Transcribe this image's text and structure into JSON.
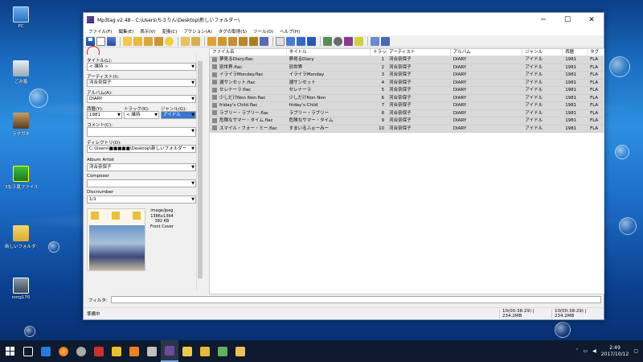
{
  "window": {
    "title": "Mp3tag v2.48 - C:\\Users\\ちさりん\\Desktop\\新しいフォルダー\\",
    "minimize": "─",
    "maximize": "☐",
    "close": "✕"
  },
  "menu": [
    "ファイル(F)",
    "編集(E)",
    "表示(V)",
    "変換(C)",
    "アクション(A)",
    "タグの取得(S)",
    "ツール(O)",
    "ヘルプ(H)"
  ],
  "desktop_icons": [
    {
      "label": "PC"
    },
    {
      "label": "ごみ箱"
    },
    {
      "label": "ラクガキ"
    },
    {
      "label": "3もう夏ファイル"
    },
    {
      "label": "新しいフォルダー"
    },
    {
      "label": "nmg170"
    }
  ],
  "left_panel": {
    "title_label": "タイトル(L):",
    "title_value": "< 維持 >",
    "artist_label": "アーティスト(I):",
    "artist_value": "河合奈保子",
    "album_label": "アルバム(A):",
    "album_value": "DIARY",
    "year_label": "西暦(Y):",
    "year_value": "1981",
    "track_label": "トラック(K):",
    "track_value": "< 維持",
    "genre_label": "ジャンル(G):",
    "genre_value": "アイドル",
    "comment_label": "コメント(C):",
    "comment_value": "",
    "directory_label": "ディレクトリ(D):",
    "directory_value": "C:\\Users\\■■■■■\\Desktop\\新しいフォルダー",
    "album_artist_label": "Album Artist",
    "album_artist_value": "河合奈保子",
    "composer_label": "Composer",
    "composer_value": "",
    "discnumber_label": "Discnumber",
    "discnumber_value": "1/1",
    "cover_info": [
      "image/jpeg",
      "1386x1394",
      "382 KB",
      "Front Cover"
    ]
  },
  "list": {
    "headers": [
      "ファイル名",
      "タイトル",
      "トラック",
      "アーティスト",
      "アルバム",
      "ジャンル",
      "西暦",
      "タグ"
    ],
    "rows": [
      {
        "file": "夢見るDiary.flac",
        "title": "夢見るDiary",
        "track": "1",
        "artist": "河合奈保子",
        "album": "DIARY",
        "genre": "アイドル",
        "year": "1981",
        "tag": "FLA"
      },
      {
        "file": "別世界.flac",
        "title": "別世界",
        "track": "2",
        "artist": "河合奈保子",
        "album": "DIARY",
        "genre": "アイドル",
        "year": "1981",
        "tag": "FLA"
      },
      {
        "file": "イライラMonday.flac",
        "title": "イライラMonday",
        "track": "3",
        "artist": "河合奈保子",
        "album": "DIARY",
        "genre": "アイドル",
        "year": "1981",
        "tag": "FLA"
      },
      {
        "file": "湖サンセット.flac",
        "title": "湖サンセット",
        "track": "4",
        "artist": "河合奈保子",
        "album": "DIARY",
        "genre": "アイドル",
        "year": "1981",
        "tag": "FLA"
      },
      {
        "file": "セレナーラ.flac",
        "title": "セレナーラ",
        "track": "5",
        "artist": "河合奈保子",
        "album": "DIARY",
        "genre": "アイドル",
        "year": "1981",
        "tag": "FLA"
      },
      {
        "file": "少しだけNon Non.flac",
        "title": "少しだけNon Non",
        "track": "6",
        "artist": "河合奈保子",
        "album": "DIARY",
        "genre": "アイドル",
        "year": "1981",
        "tag": "FLA"
      },
      {
        "file": "friday's Child.flac",
        "title": "friday's Child",
        "track": "7",
        "artist": "河合奈保子",
        "album": "DIARY",
        "genre": "アイドル",
        "year": "1981",
        "tag": "FLA"
      },
      {
        "file": "ラブリー・ラブリー.flac",
        "title": "ラブリー・ラブリー",
        "track": "8",
        "artist": "河合奈保子",
        "album": "DIARY",
        "genre": "アイドル",
        "year": "1981",
        "tag": "FLA"
      },
      {
        "file": "危険なサマー・タイム.flac",
        "title": "危険なサマー・タイム",
        "track": "9",
        "artist": "河合奈保子",
        "album": "DIARY",
        "genre": "アイドル",
        "year": "1981",
        "tag": "FLA"
      },
      {
        "file": "スマイル・フォー・ミー.flac",
        "title": "すまいるふぉーみー",
        "track": "10",
        "artist": "河合奈保子",
        "album": "DIARY",
        "genre": "アイドル",
        "year": "1981",
        "tag": "FLA"
      }
    ]
  },
  "filter_label": "フィルタ:",
  "status": {
    "left": "準備中",
    "mid": "10(00:38:29) | 234.2MB",
    "right": "10(00:38:29) | 234.2MB"
  },
  "clock": {
    "time": "2:49",
    "date": "2017/10/12"
  }
}
